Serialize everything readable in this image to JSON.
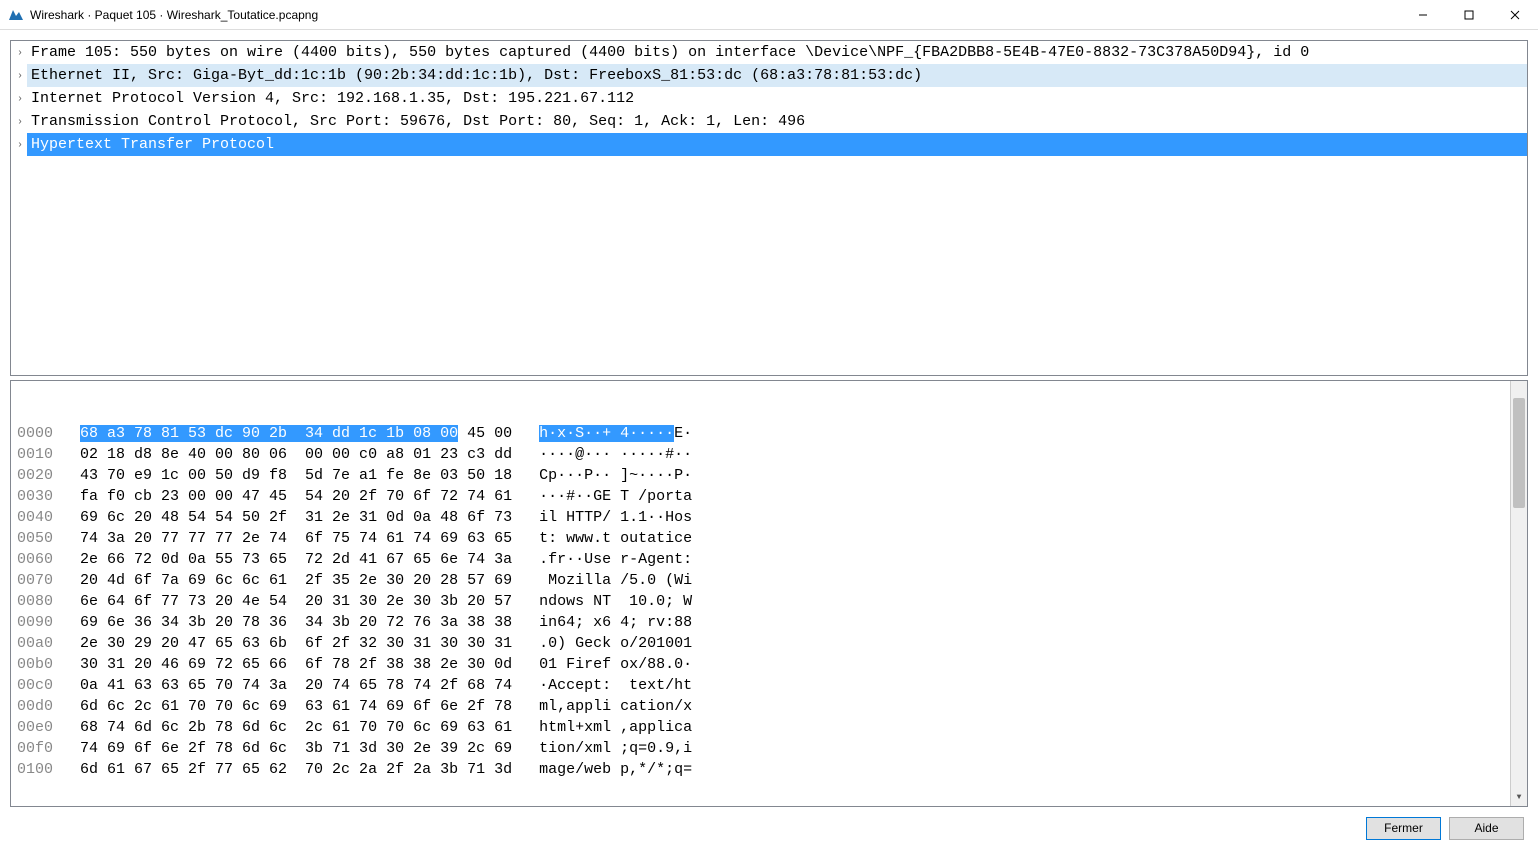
{
  "window": {
    "title": "Wireshark · Paquet 105 · Wireshark_Toutatice.pcapng"
  },
  "tree": {
    "items": [
      {
        "label": "Frame 105: 550 bytes on wire (4400 bits), 550 bytes captured (4400 bits) on interface \\Device\\NPF_{FBA2DBB8-5E4B-47E0-8832-73C378A50D94}, id 0",
        "bg": "none"
      },
      {
        "label": "Ethernet II, Src: Giga-Byt_dd:1c:1b (90:2b:34:dd:1c:1b), Dst: FreeboxS_81:53:dc (68:a3:78:81:53:dc)",
        "bg": "light"
      },
      {
        "label": "Internet Protocol Version 4, Src: 192.168.1.35, Dst: 195.221.67.112",
        "bg": "none"
      },
      {
        "label": "Transmission Control Protocol, Src Port: 59676, Dst Port: 80, Seq: 1, Ack: 1, Len: 496",
        "bg": "none"
      },
      {
        "label": "Hypertext Transfer Protocol",
        "bg": "sel"
      }
    ]
  },
  "hex": {
    "highlight_bytes": "68 a3 78 81 53 dc 90 2b  34 dd 1c 1b 08 00",
    "highlight_ascii": "h·x·S··+ 4·····",
    "line0_rest_bytes": " 45 00",
    "line0_rest_ascii": "E·",
    "lines": [
      {
        "offset": "0000",
        "bytes": "",
        "ascii": ""
      },
      {
        "offset": "0010",
        "bytes": "02 18 d8 8e 40 00 80 06  00 00 c0 a8 01 23 c3 dd",
        "ascii": "····@··· ·····#··"
      },
      {
        "offset": "0020",
        "bytes": "43 70 e9 1c 00 50 d9 f8  5d 7e a1 fe 8e 03 50 18",
        "ascii": "Cp···P·· ]~····P·"
      },
      {
        "offset": "0030",
        "bytes": "fa f0 cb 23 00 00 47 45  54 20 2f 70 6f 72 74 61",
        "ascii": "···#··GE T /porta"
      },
      {
        "offset": "0040",
        "bytes": "69 6c 20 48 54 54 50 2f  31 2e 31 0d 0a 48 6f 73",
        "ascii": "il HTTP/ 1.1··Hos"
      },
      {
        "offset": "0050",
        "bytes": "74 3a 20 77 77 77 2e 74  6f 75 74 61 74 69 63 65",
        "ascii": "t: www.t outatice"
      },
      {
        "offset": "0060",
        "bytes": "2e 66 72 0d 0a 55 73 65  72 2d 41 67 65 6e 74 3a",
        "ascii": ".fr··Use r-Agent:"
      },
      {
        "offset": "0070",
        "bytes": "20 4d 6f 7a 69 6c 6c 61  2f 35 2e 30 20 28 57 69",
        "ascii": " Mozilla /5.0 (Wi"
      },
      {
        "offset": "0080",
        "bytes": "6e 64 6f 77 73 20 4e 54  20 31 30 2e 30 3b 20 57",
        "ascii": "ndows NT  10.0; W"
      },
      {
        "offset": "0090",
        "bytes": "69 6e 36 34 3b 20 78 36  34 3b 20 72 76 3a 38 38",
        "ascii": "in64; x6 4; rv:88"
      },
      {
        "offset": "00a0",
        "bytes": "2e 30 29 20 47 65 63 6b  6f 2f 32 30 31 30 30 31",
        "ascii": ".0) Geck o/201001"
      },
      {
        "offset": "00b0",
        "bytes": "30 31 20 46 69 72 65 66  6f 78 2f 38 38 2e 30 0d",
        "ascii": "01 Firef ox/88.0·"
      },
      {
        "offset": "00c0",
        "bytes": "0a 41 63 63 65 70 74 3a  20 74 65 78 74 2f 68 74",
        "ascii": "·Accept:  text/ht"
      },
      {
        "offset": "00d0",
        "bytes": "6d 6c 2c 61 70 70 6c 69  63 61 74 69 6f 6e 2f 78",
        "ascii": "ml,appli cation/x"
      },
      {
        "offset": "00e0",
        "bytes": "68 74 6d 6c 2b 78 6d 6c  2c 61 70 70 6c 69 63 61",
        "ascii": "html+xml ,applica"
      },
      {
        "offset": "00f0",
        "bytes": "74 69 6f 6e 2f 78 6d 6c  3b 71 3d 30 2e 39 2c 69",
        "ascii": "tion/xml ;q=0.9,i"
      },
      {
        "offset": "0100",
        "bytes": "6d 61 67 65 2f 77 65 62  70 2c 2a 2f 2a 3b 71 3d",
        "ascii": "mage/web p,*/*;q="
      }
    ]
  },
  "footer": {
    "close_label": "Fermer",
    "help_label": "Aide"
  }
}
